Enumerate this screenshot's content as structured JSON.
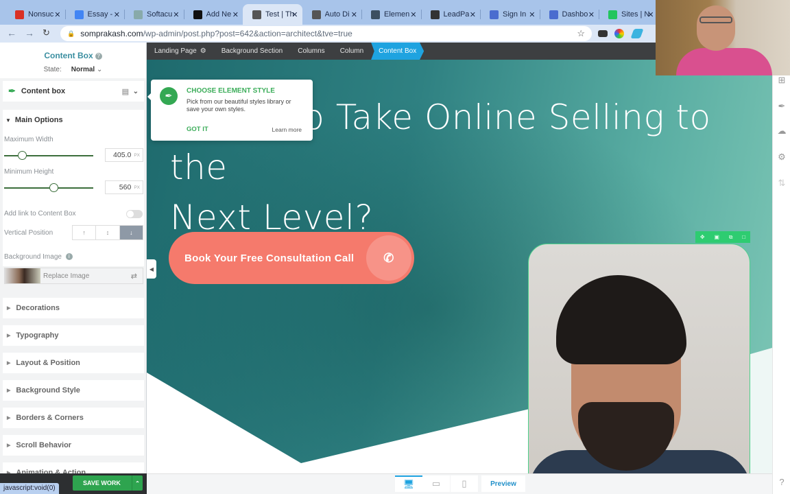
{
  "browser": {
    "tabs": [
      {
        "label": "Nonsuc",
        "icon": "gmail-icon",
        "color": "#d93025"
      },
      {
        "label": "Essay -",
        "icon": "docs-icon",
        "color": "#4285f4"
      },
      {
        "label": "Softacu",
        "icon": "softaculous-icon",
        "color": "#8aa"
      },
      {
        "label": "Add Ne",
        "icon": "sp-icon",
        "color": "#111"
      },
      {
        "label": "Test | Th",
        "icon": "globe-icon",
        "color": "#555",
        "active": true
      },
      {
        "label": "Auto Di",
        "icon": "globe-icon",
        "color": "#555"
      },
      {
        "label": "Elemen",
        "icon": "g-icon",
        "color": "#3c4f60"
      },
      {
        "label": "LeadPa",
        "icon": "leadpages-icon",
        "color": "#333"
      },
      {
        "label": "Sign In",
        "icon": "cb-icon",
        "color": "#4a6ccf"
      },
      {
        "label": "Dashbo",
        "icon": "cb-icon",
        "color": "#4a6ccf"
      },
      {
        "label": "Sites | N",
        "icon": "sites-icon",
        "color": "#22c55e"
      }
    ],
    "url_host": "somprakash.com",
    "url_path": "/wp-admin/post.php?post=642&action=architect&tve=true",
    "status_url": "javascript:void(0)"
  },
  "panel": {
    "title": "Content Box",
    "state_label": "State:",
    "state_value": "Normal",
    "element_label": "Content box",
    "main_options": "Main Options",
    "max_width_label": "Maximum Width",
    "max_width_value": "405.0",
    "max_width_unit": "PX",
    "max_width_slider": 0.2,
    "min_height_label": "Minimum Height",
    "min_height_value": "560",
    "min_height_unit": "PX",
    "min_height_slider": 0.55,
    "link_label": "Add link to Content Box",
    "link_enabled": false,
    "vpos_label": "Vertical Position",
    "vpos_options": [
      "top",
      "middle",
      "bottom"
    ],
    "vpos_selected": "bottom",
    "bg_image_label": "Background Image",
    "replace_image": "Replace Image",
    "sections": [
      "Decorations",
      "Typography",
      "Layout & Position",
      "Background Style",
      "Borders & Corners",
      "Scroll Behavior",
      "Animation & Action"
    ],
    "save_label": "SAVE WORK"
  },
  "breadcrumbs": [
    "Landing Page",
    "Background Section",
    "Columns",
    "Column",
    "Content Box"
  ],
  "tooltip": {
    "title": "CHOOSE ELEMENT STYLE",
    "desc": "Pick from our beautiful styles library or save your own styles.",
    "got_it": "GOT IT",
    "learn_more": "Learn more"
  },
  "canvas": {
    "headline_line1": "Ready to Take Online Selling to the",
    "headline_line2": "Next Level?",
    "cta_label": "Book Your Free Consultation Call"
  },
  "devices": {
    "selected": "desktop",
    "preview": "Preview"
  }
}
